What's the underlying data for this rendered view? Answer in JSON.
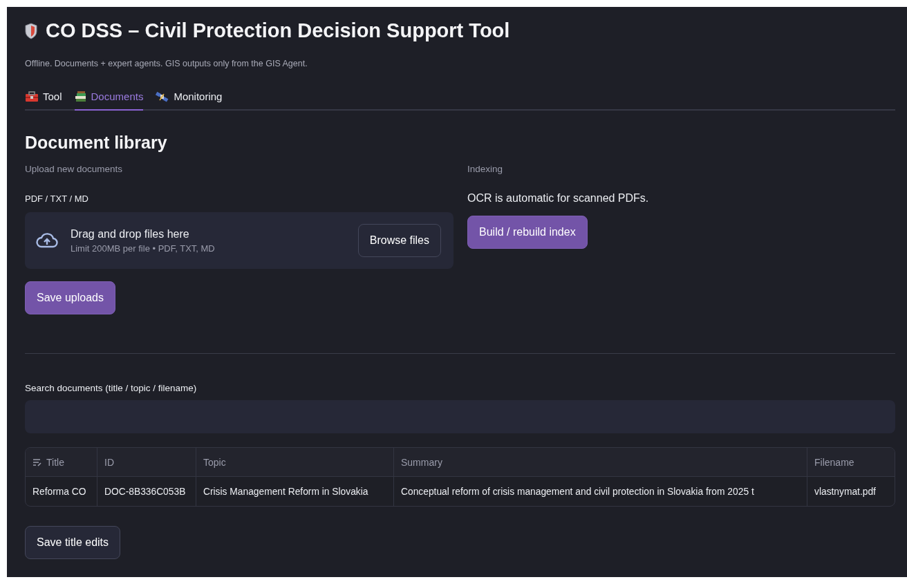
{
  "header": {
    "title": "CO DSS – Civil Protection Decision Support Tool",
    "subtitle": "Offline. Documents + expert agents. GIS outputs only from the GIS Agent."
  },
  "tabs": [
    {
      "label": "Tool",
      "selected": false
    },
    {
      "label": "Documents",
      "selected": true
    },
    {
      "label": "Monitoring",
      "selected": false
    }
  ],
  "library": {
    "heading": "Document library",
    "upload": {
      "caption": "Upload new documents",
      "label": "PDF / TXT / MD",
      "drop_text": "Drag and drop files here",
      "limit": "Limit 200MB per file • PDF, TXT, MD",
      "browse_button": "Browse files",
      "save_button": "Save uploads"
    },
    "indexing": {
      "caption": "Indexing",
      "note": "OCR is automatic for scanned PDFs.",
      "build_button": "Build / rebuild index"
    }
  },
  "search": {
    "label": "Search documents (title / topic / filename)"
  },
  "table": {
    "columns": [
      {
        "label": "Title",
        "editable": true
      },
      {
        "label": "ID",
        "editable": false
      },
      {
        "label": "Topic",
        "editable": false
      },
      {
        "label": "Summary",
        "editable": false
      },
      {
        "label": "Filename",
        "editable": false
      }
    ],
    "rows": [
      [
        "Reforma CO",
        "DOC-8B336C053B",
        "Crisis Management Reform in Slovakia",
        "Conceptual reform of crisis management and civil protection in Slovakia from 2025 t",
        "vlastnymat.pdf"
      ]
    ]
  },
  "save_title_button": "Save title edits"
}
